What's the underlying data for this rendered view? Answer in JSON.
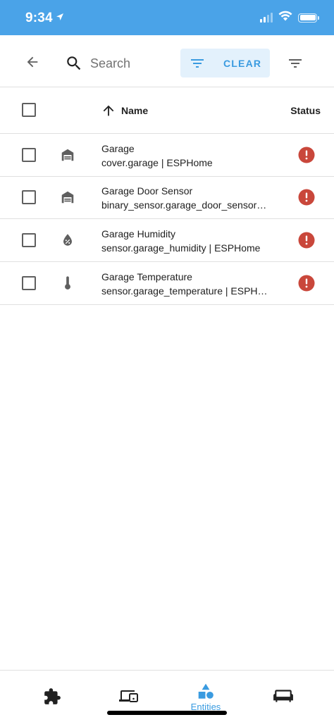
{
  "status_bar": {
    "time": "9:34"
  },
  "toolbar": {
    "search_placeholder": "Search",
    "clear_label": "CLEAR"
  },
  "table": {
    "columns": {
      "name": "Name",
      "status": "Status"
    },
    "rows": [
      {
        "name": "Garage",
        "sub": "cover.garage | ESPHome",
        "icon": "garage-icon"
      },
      {
        "name": "Garage Door Sensor",
        "sub": "binary_sensor.garage_door_sensor | ESPHome",
        "icon": "garage-icon"
      },
      {
        "name": "Garage Humidity",
        "sub": "sensor.garage_humidity | ESPHome",
        "icon": "humidity-icon"
      },
      {
        "name": "Garage Temperature",
        "sub": "sensor.garage_temperature | ESPHome",
        "icon": "thermometer-icon"
      }
    ]
  },
  "bottom_nav": {
    "items": [
      {
        "icon": "puzzle-icon",
        "label": ""
      },
      {
        "icon": "devices-icon",
        "label": ""
      },
      {
        "icon": "shapes-icon",
        "label": "Entities",
        "active": true
      },
      {
        "icon": "sofa-icon",
        "label": ""
      }
    ]
  },
  "colors": {
    "accent": "#3a9be0",
    "status_bar": "#4aa3e8",
    "chip_bg": "#e3f1fc",
    "error": "#c9473b",
    "icon_gray": "#5f5f5f"
  }
}
